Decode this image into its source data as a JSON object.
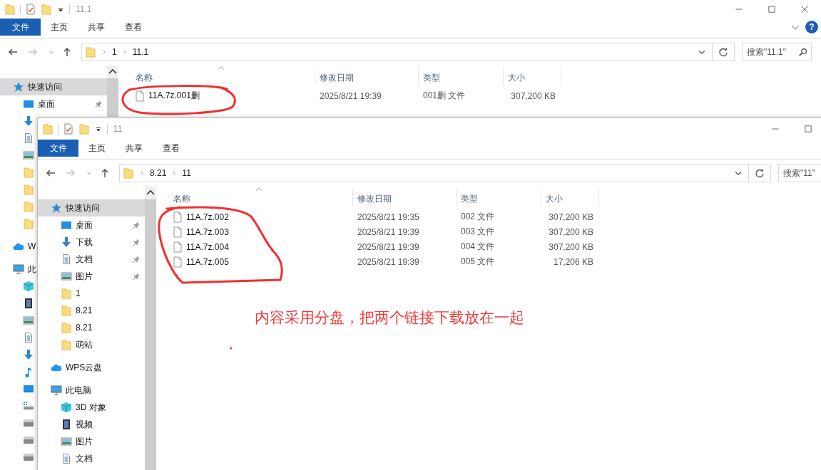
{
  "windows": [
    {
      "title": "11.1",
      "controls": [
        {
          "kind": "minimize"
        },
        {
          "kind": "maximize"
        },
        {
          "kind": "close"
        }
      ],
      "ribbon_tabs": [
        {
          "label": "文件",
          "kind": "menu"
        },
        {
          "label": "主页",
          "kind": "tab"
        },
        {
          "label": "共享",
          "kind": "tab"
        },
        {
          "label": "查看",
          "kind": "tab"
        }
      ],
      "help": "?",
      "forward_disabled": true,
      "address": [
        "1",
        "11.1"
      ],
      "search": {
        "placeholder": "搜索\"11.1\"",
        "icon": true
      },
      "nav_pane": [
        {
          "label": "快速访问",
          "kind": "star",
          "selected": true,
          "children": [
            {
              "label": "桌面",
              "kind": "desktop",
              "selected": false,
              "pinned": true
            },
            {
              "kind": "download",
              "selected": false
            },
            {
              "kind": "document",
              "selected": false
            },
            {
              "kind": "picture",
              "selected": false
            },
            {
              "kind": "folder",
              "selected": false
            },
            {
              "kind": "folder",
              "selected": false
            },
            {
              "kind": "folder",
              "selected": false
            },
            {
              "kind": "folder",
              "selected": false
            }
          ]
        },
        {
          "label": "W",
          "kind": "cloud",
          "selected": false
        },
        {
          "label": "此",
          "kind": "pc",
          "selected": false,
          "children": [
            {
              "kind": "cube",
              "selected": false
            },
            {
              "kind": "video",
              "selected": false
            },
            {
              "kind": "picture",
              "selected": false
            },
            {
              "kind": "document",
              "selected": false
            },
            {
              "kind": "download",
              "selected": false
            },
            {
              "kind": "music",
              "selected": false
            },
            {
              "kind": "desktop",
              "selected": false
            },
            {
              "kind": "drive-system",
              "selected": false
            },
            {
              "kind": "drive",
              "selected": false
            },
            {
              "kind": "drive",
              "selected": false
            },
            {
              "kind": "drive",
              "selected": false
            }
          ]
        }
      ],
      "columns": [
        {
          "label": "名称",
          "sorted": true
        },
        {
          "label": "修改日期",
          "sorted": false
        },
        {
          "label": "类型",
          "sorted": false
        },
        {
          "label": "大小",
          "sorted": false
        }
      ],
      "files": [
        {
          "name": "11A.7z.001删",
          "modified": "2025/8/21 19:39",
          "type": "001删 文件",
          "size": "307,200 KB"
        }
      ]
    },
    {
      "title": "11",
      "controls": [
        {
          "kind": "minimize"
        },
        {
          "kind": "maximize"
        }
      ],
      "ribbon_tabs": [
        {
          "label": "文件",
          "kind": "menu"
        },
        {
          "label": "主页",
          "kind": "tab"
        },
        {
          "label": "共享",
          "kind": "tab"
        },
        {
          "label": "查看",
          "kind": "tab"
        }
      ],
      "forward_disabled": true,
      "address": [
        "8.21",
        "11"
      ],
      "search": {
        "placeholder": "搜索\"11\""
      },
      "nav_pane": [
        {
          "label": "快速访问",
          "kind": "star",
          "selected": true,
          "children": [
            {
              "label": "桌面",
              "kind": "desktop",
              "selected": false,
              "pinned": true
            },
            {
              "label": "下载",
              "kind": "download",
              "selected": false,
              "pinned": true
            },
            {
              "label": "文档",
              "kind": "document",
              "selected": false,
              "pinned": true
            },
            {
              "label": "图片",
              "kind": "picture",
              "selected": false,
              "pinned": true
            },
            {
              "label": "1",
              "kind": "folder",
              "selected": false,
              "pinned": false
            },
            {
              "label": "8.21",
              "kind": "folder",
              "selected": false,
              "pinned": false
            },
            {
              "label": "8.21",
              "kind": "folder",
              "selected": false,
              "pinned": false
            },
            {
              "label": "萌站",
              "kind": "folder",
              "selected": false,
              "pinned": false
            }
          ]
        },
        {
          "label": "WPS云盘",
          "kind": "cloud",
          "selected": false
        },
        {
          "label": "此电脑",
          "kind": "pc",
          "selected": false,
          "children": [
            {
              "label": "3D 对象",
              "kind": "cube",
              "selected": false
            },
            {
              "label": "视频",
              "kind": "video",
              "selected": false
            },
            {
              "label": "图片",
              "kind": "picture",
              "selected": false
            },
            {
              "label": "文档",
              "kind": "document",
              "selected": false
            }
          ]
        }
      ],
      "columns": [
        {
          "label": "名称",
          "sorted": true
        },
        {
          "label": "修改日期",
          "sorted": false
        },
        {
          "label": "类型",
          "sorted": false
        },
        {
          "label": "大小",
          "sorted": false
        }
      ],
      "files": [
        {
          "name": "11A.7z.002",
          "modified": "2025/8/21 19:35",
          "type": "002 文件",
          "size": "307,200 KB"
        },
        {
          "name": "11A.7z.003",
          "modified": "2025/8/21 19:39",
          "type": "003 文件",
          "size": "307,200 KB"
        },
        {
          "name": "11A.7z.004",
          "modified": "2025/8/21 19:39",
          "type": "004 文件",
          "size": "307,200 KB"
        },
        {
          "name": "11A.7z.005",
          "modified": "2025/8/21 19:39",
          "type": "005 文件",
          "size": "17,206 KB"
        }
      ]
    }
  ],
  "annotation": {
    "note": "内容采用分盘，把两个链接下载放在一起"
  }
}
